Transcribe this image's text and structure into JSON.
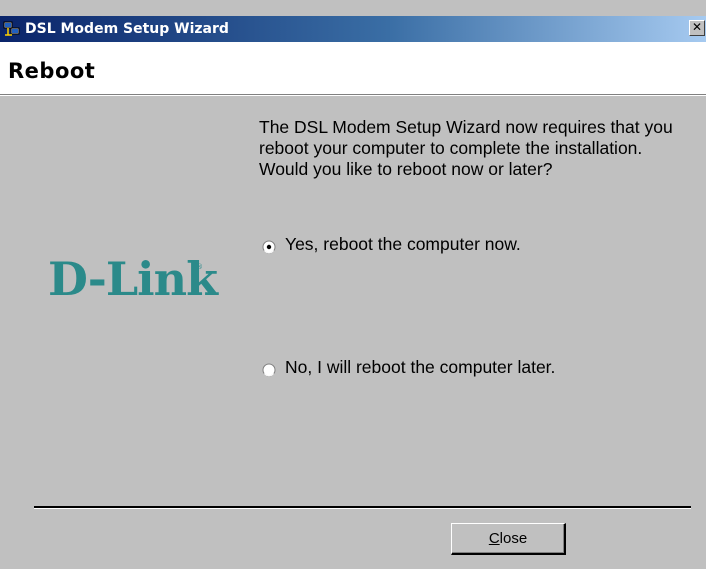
{
  "window": {
    "title": "DSL Modem Setup Wizard",
    "close_glyph": "✕",
    "icon": "network-computer-icon"
  },
  "header": {
    "title": "Reboot"
  },
  "logo": {
    "text": "D-Link",
    "registered": "®",
    "color": "#2b8a8a"
  },
  "body": {
    "message": "The DSL Modem Setup Wizard now requires that you reboot your computer to complete the installation.  Would you like to reboot now or later?",
    "options": [
      {
        "label": "Yes, reboot the computer now.",
        "selected": true
      },
      {
        "label": "No, I will reboot the computer later.",
        "selected": false
      }
    ]
  },
  "footer": {
    "close_button": {
      "mnemonic": "C",
      "rest": "lose"
    }
  },
  "colors": {
    "titlebar_start": "#0a246a",
    "titlebar_end": "#a6caf0",
    "dialog_bg": "#c0c0c0",
    "header_bg": "#ffffff"
  }
}
